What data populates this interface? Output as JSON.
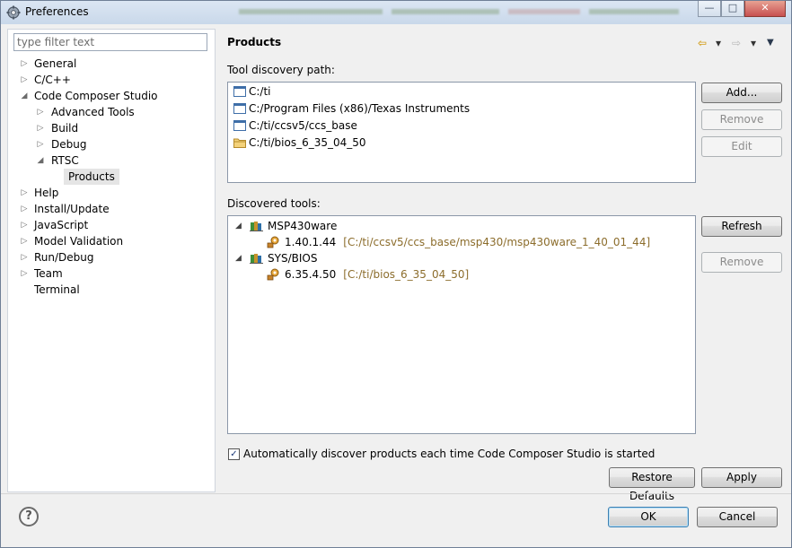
{
  "window": {
    "title": "Preferences",
    "minimize": "—",
    "maximize": "□",
    "close": "✕"
  },
  "filter": {
    "placeholder": "type filter text",
    "value": ""
  },
  "tree": [
    {
      "label": "General",
      "twisty": "▷"
    },
    {
      "label": "C/C++",
      "twisty": "▷"
    },
    {
      "label": "Code Composer Studio",
      "twisty": "◢"
    },
    {
      "label": "Advanced Tools",
      "twisty": "▷"
    },
    {
      "label": "Build",
      "twisty": "▷"
    },
    {
      "label": "Debug",
      "twisty": "▷"
    },
    {
      "label": "RTSC",
      "twisty": "◢"
    },
    {
      "label": "Products",
      "twisty": ""
    },
    {
      "label": "Help",
      "twisty": "▷"
    },
    {
      "label": "Install/Update",
      "twisty": "▷"
    },
    {
      "label": "JavaScript",
      "twisty": "▷"
    },
    {
      "label": "Model Validation",
      "twisty": "▷"
    },
    {
      "label": "Run/Debug",
      "twisty": "▷"
    },
    {
      "label": "Team",
      "twisty": "▷"
    },
    {
      "label": "Terminal",
      "twisty": ""
    }
  ],
  "page": {
    "title": "Products",
    "nav": {
      "back": "⇦",
      "forward": "⇨",
      "dropdown": "▾",
      "menu": "▼"
    }
  },
  "discovery": {
    "label": "Tool discovery path:",
    "paths": [
      {
        "text": "C:/ti",
        "icon": "file-icon"
      },
      {
        "text": "C:/Program Files (x86)/Texas Instruments",
        "icon": "file-icon"
      },
      {
        "text": "C:/ti/ccsv5/ccs_base",
        "icon": "file-icon"
      },
      {
        "text": "C:/ti/bios_6_35_04_50",
        "icon": "folder-icon"
      }
    ],
    "buttons": {
      "add": "Add...",
      "remove": "Remove",
      "edit": "Edit"
    }
  },
  "discovered": {
    "label": "Discovered tools:",
    "tools": [
      {
        "name": "MSP430ware",
        "version": "1.40.1.44",
        "path": "[C:/ti/ccsv5/ccs_base/msp430/msp430ware_1_40_01_44]"
      },
      {
        "name": "SYS/BIOS",
        "version": "6.35.4.50",
        "path": "[C:/ti/bios_6_35_04_50]"
      }
    ],
    "buttons": {
      "refresh": "Refresh",
      "remove": "Remove"
    }
  },
  "auto_discover": {
    "label": "Automatically discover products each time Code Composer Studio is started",
    "checked": true
  },
  "footer": {
    "restore": "Restore Defaults",
    "apply": "Apply",
    "ok": "OK",
    "cancel": "Cancel",
    "help": "?"
  },
  "colors": {
    "highlight_row": "#fefbd8",
    "tool_path": "#8c6d2c",
    "selection": "#e5e5e5"
  }
}
